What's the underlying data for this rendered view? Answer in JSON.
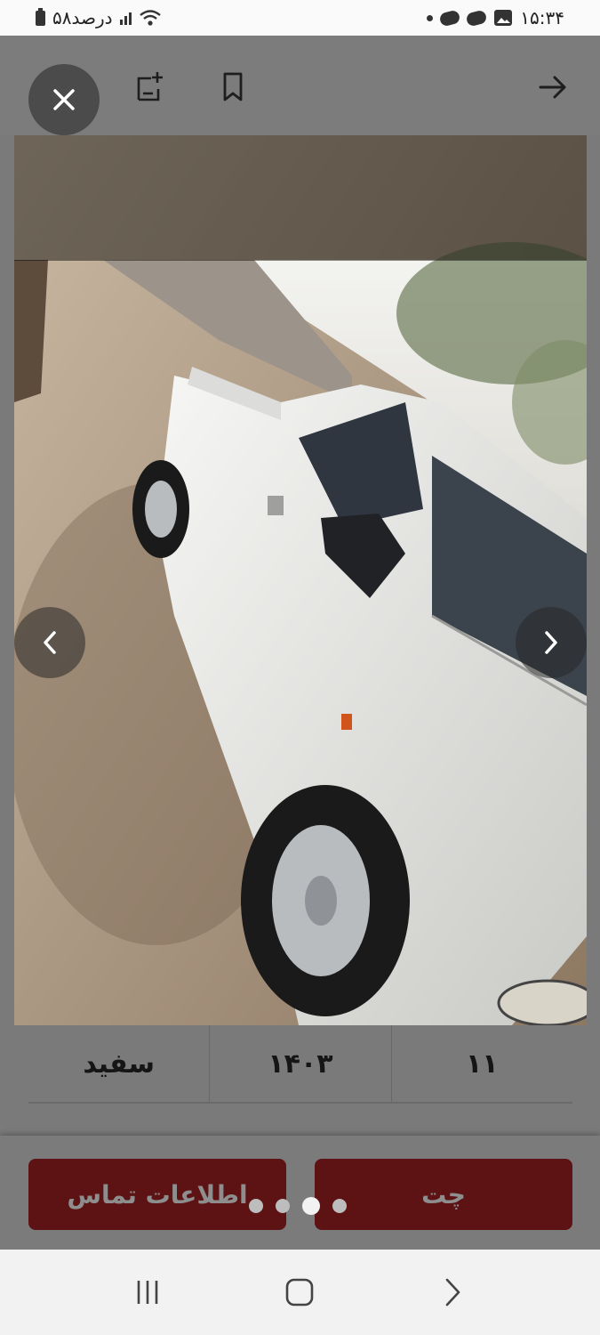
{
  "status_bar": {
    "time": "۱۵:۳۴",
    "battery": "۵۸درصد"
  },
  "viewer": {
    "photo_description_icon": "car-photo",
    "page_count": 4,
    "active_page": 3
  },
  "specs": {
    "color": "سفید",
    "year": "۱۴۰۳",
    "mileage": "۱۱"
  },
  "actions": {
    "contact_label": "اطلاعات تماس",
    "chat_label": "چت"
  },
  "colors": {
    "accent": "#5d1214",
    "overlay": "#7b7b7b"
  }
}
